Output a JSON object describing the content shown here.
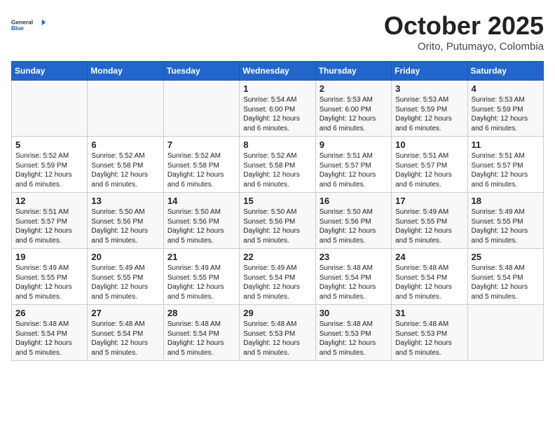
{
  "header": {
    "logo_line1": "General",
    "logo_line2": "Blue",
    "month_title": "October 2025",
    "subtitle": "Orito, Putumayo, Colombia"
  },
  "weekdays": [
    "Sunday",
    "Monday",
    "Tuesday",
    "Wednesday",
    "Thursday",
    "Friday",
    "Saturday"
  ],
  "weeks": [
    [
      {
        "day": "",
        "content": ""
      },
      {
        "day": "",
        "content": ""
      },
      {
        "day": "",
        "content": ""
      },
      {
        "day": "1",
        "content": "Sunrise: 5:54 AM\nSunset: 6:00 PM\nDaylight: 12 hours\nand 6 minutes."
      },
      {
        "day": "2",
        "content": "Sunrise: 5:53 AM\nSunset: 6:00 PM\nDaylight: 12 hours\nand 6 minutes."
      },
      {
        "day": "3",
        "content": "Sunrise: 5:53 AM\nSunset: 5:59 PM\nDaylight: 12 hours\nand 6 minutes."
      },
      {
        "day": "4",
        "content": "Sunrise: 5:53 AM\nSunset: 5:59 PM\nDaylight: 12 hours\nand 6 minutes."
      }
    ],
    [
      {
        "day": "5",
        "content": "Sunrise: 5:52 AM\nSunset: 5:59 PM\nDaylight: 12 hours\nand 6 minutes."
      },
      {
        "day": "6",
        "content": "Sunrise: 5:52 AM\nSunset: 5:58 PM\nDaylight: 12 hours\nand 6 minutes."
      },
      {
        "day": "7",
        "content": "Sunrise: 5:52 AM\nSunset: 5:58 PM\nDaylight: 12 hours\nand 6 minutes."
      },
      {
        "day": "8",
        "content": "Sunrise: 5:52 AM\nSunset: 5:58 PM\nDaylight: 12 hours\nand 6 minutes."
      },
      {
        "day": "9",
        "content": "Sunrise: 5:51 AM\nSunset: 5:57 PM\nDaylight: 12 hours\nand 6 minutes."
      },
      {
        "day": "10",
        "content": "Sunrise: 5:51 AM\nSunset: 5:57 PM\nDaylight: 12 hours\nand 6 minutes."
      },
      {
        "day": "11",
        "content": "Sunrise: 5:51 AM\nSunset: 5:57 PM\nDaylight: 12 hours\nand 6 minutes."
      }
    ],
    [
      {
        "day": "12",
        "content": "Sunrise: 5:51 AM\nSunset: 5:57 PM\nDaylight: 12 hours\nand 6 minutes."
      },
      {
        "day": "13",
        "content": "Sunrise: 5:50 AM\nSunset: 5:56 PM\nDaylight: 12 hours\nand 5 minutes."
      },
      {
        "day": "14",
        "content": "Sunrise: 5:50 AM\nSunset: 5:56 PM\nDaylight: 12 hours\nand 5 minutes."
      },
      {
        "day": "15",
        "content": "Sunrise: 5:50 AM\nSunset: 5:56 PM\nDaylight: 12 hours\nand 5 minutes."
      },
      {
        "day": "16",
        "content": "Sunrise: 5:50 AM\nSunset: 5:56 PM\nDaylight: 12 hours\nand 5 minutes."
      },
      {
        "day": "17",
        "content": "Sunrise: 5:49 AM\nSunset: 5:55 PM\nDaylight: 12 hours\nand 5 minutes."
      },
      {
        "day": "18",
        "content": "Sunrise: 5:49 AM\nSunset: 5:55 PM\nDaylight: 12 hours\nand 5 minutes."
      }
    ],
    [
      {
        "day": "19",
        "content": "Sunrise: 5:49 AM\nSunset: 5:55 PM\nDaylight: 12 hours\nand 5 minutes."
      },
      {
        "day": "20",
        "content": "Sunrise: 5:49 AM\nSunset: 5:55 PM\nDaylight: 12 hours\nand 5 minutes."
      },
      {
        "day": "21",
        "content": "Sunrise: 5:49 AM\nSunset: 5:55 PM\nDaylight: 12 hours\nand 5 minutes."
      },
      {
        "day": "22",
        "content": "Sunrise: 5:49 AM\nSunset: 5:54 PM\nDaylight: 12 hours\nand 5 minutes."
      },
      {
        "day": "23",
        "content": "Sunrise: 5:48 AM\nSunset: 5:54 PM\nDaylight: 12 hours\nand 5 minutes."
      },
      {
        "day": "24",
        "content": "Sunrise: 5:48 AM\nSunset: 5:54 PM\nDaylight: 12 hours\nand 5 minutes."
      },
      {
        "day": "25",
        "content": "Sunrise: 5:48 AM\nSunset: 5:54 PM\nDaylight: 12 hours\nand 5 minutes."
      }
    ],
    [
      {
        "day": "26",
        "content": "Sunrise: 5:48 AM\nSunset: 5:54 PM\nDaylight: 12 hours\nand 5 minutes."
      },
      {
        "day": "27",
        "content": "Sunrise: 5:48 AM\nSunset: 5:54 PM\nDaylight: 12 hours\nand 5 minutes."
      },
      {
        "day": "28",
        "content": "Sunrise: 5:48 AM\nSunset: 5:54 PM\nDaylight: 12 hours\nand 5 minutes."
      },
      {
        "day": "29",
        "content": "Sunrise: 5:48 AM\nSunset: 5:53 PM\nDaylight: 12 hours\nand 5 minutes."
      },
      {
        "day": "30",
        "content": "Sunrise: 5:48 AM\nSunset: 5:53 PM\nDaylight: 12 hours\nand 5 minutes."
      },
      {
        "day": "31",
        "content": "Sunrise: 5:48 AM\nSunset: 5:53 PM\nDaylight: 12 hours\nand 5 minutes."
      },
      {
        "day": "",
        "content": ""
      }
    ]
  ]
}
